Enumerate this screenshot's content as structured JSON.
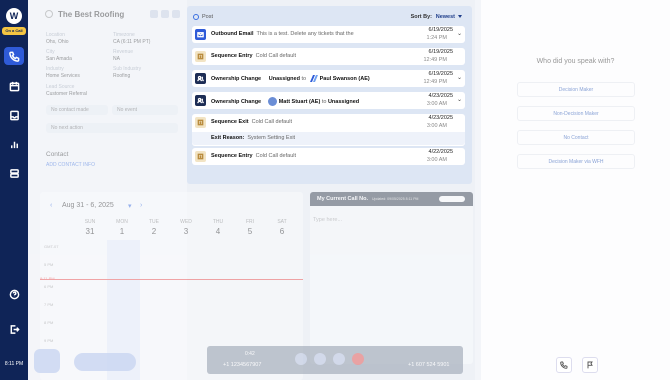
{
  "rail": {
    "logo_letter": "W",
    "status_badge": "On a Call",
    "clock": "8:11 PM"
  },
  "contact": {
    "company": "The Best Roofing",
    "fields": [
      {
        "label": "Location",
        "value": "Ohs, Ohio"
      },
      {
        "label": "Timezone",
        "value": "CA (6:11 PM PT)"
      },
      {
        "label": "City",
        "value": "San Amada"
      },
      {
        "label": "Revenue",
        "value": "NA"
      },
      {
        "label": "Industry",
        "value": "Home Services"
      },
      {
        "label": "Sub Industry",
        "value": "Roofing"
      },
      {
        "label": "Lead Source",
        "value": "Customer Referral"
      }
    ],
    "last_contact_label": "No contact made",
    "last_event_label": "No event",
    "next_action_label": "No next action",
    "section_title": "Contact",
    "add_contact_label": "ADD CONTACT INFO"
  },
  "activity": {
    "post_label": "Post",
    "sort_label": "Sort By:",
    "sort_value": "Newest",
    "items": [
      {
        "type": "Outbound Email",
        "detail": "This is a test. Delete any tickets that the",
        "date": "6/19/2025",
        "time": "1:24 PM",
        "icon": "mail-icon"
      },
      {
        "type": "Sequence Entry",
        "detail": "Cold Call default",
        "date": "6/19/2025",
        "time": "12:49 PM",
        "icon": "sequence-icon"
      },
      {
        "type": "Ownership Change",
        "from": "Unassigned",
        "connector": "to",
        "to": "Paul Swanson (AE)",
        "date": "6/19/2025",
        "time": "12:49 PM",
        "icon": "users-icon"
      },
      {
        "type": "Ownership Change",
        "from": "Matt Stuart (AE)",
        "connector": "to",
        "to": "Unassigned",
        "date": "4/23/2025",
        "time": "3:00 AM",
        "icon": "users-icon"
      },
      {
        "type": "Sequence Exit",
        "detail": "Cold Call default",
        "date": "4/23/2025",
        "time": "3:00 AM",
        "exit_reason_label": "Exit Reason:",
        "exit_reason": "System Setting Exit",
        "icon": "sequence-icon"
      },
      {
        "type": "Sequence Entry",
        "detail": "Cold Call default",
        "date": "4/22/2025",
        "time": "3:00 AM",
        "icon": "sequence-icon"
      }
    ]
  },
  "calendar": {
    "range": "Aug 31 - 6, 2025",
    "days": [
      {
        "name": "SUN",
        "date": "31"
      },
      {
        "name": "MON",
        "date": "1"
      },
      {
        "name": "TUE",
        "date": "2"
      },
      {
        "name": "WED",
        "date": "3"
      },
      {
        "name": "THU",
        "date": "4"
      },
      {
        "name": "FRI",
        "date": "5"
      },
      {
        "name": "SAT",
        "date": "6"
      }
    ],
    "hours": [
      "GMT-07",
      "5 PM",
      "6 PM",
      "7 PM",
      "8 PM",
      "9 PM"
    ],
    "now_label": "8:11 PM"
  },
  "notes": {
    "title": "My Current Call No.",
    "subtitle": "Updated: 09/05/2025 8:11 PM",
    "placeholder": "Type here..."
  },
  "call": {
    "elapsed": "0:42",
    "from_number": "+1 1234567907",
    "to_number": "+1 607 524 5901"
  },
  "right_panel": {
    "question": "Who did you speak with?",
    "options": [
      "Decision Maker",
      "Non-Decision Maker",
      "No Contact",
      "Decision Maker via WFH"
    ]
  },
  "colors": {
    "rail": "#0f2457",
    "accent": "#2f5bd8",
    "badge": "#f4c542"
  }
}
